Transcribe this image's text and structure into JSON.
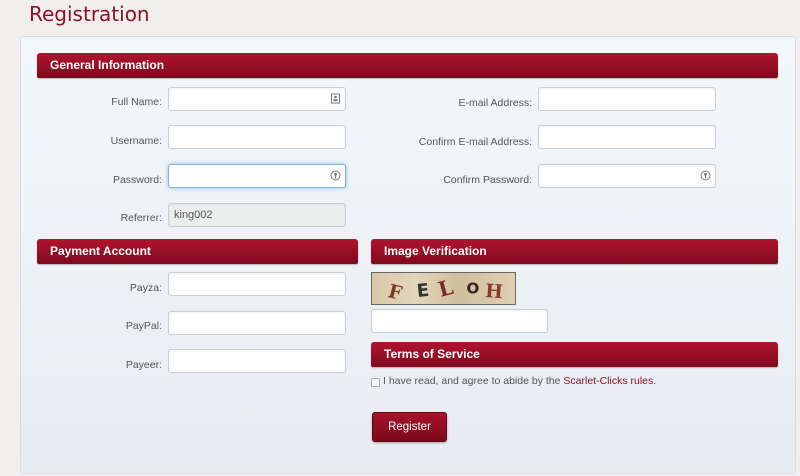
{
  "page": {
    "title": "Registration"
  },
  "general": {
    "title": "General Information",
    "full_name_label": "Full Name:",
    "username_label": "Username:",
    "password_label": "Password:",
    "referrer_label": "Referrer:",
    "referrer_value": "king002",
    "email_label": "E-mail Address:",
    "confirm_email_label": "Confirm E-mail Address:",
    "confirm_password_label": "Confirm Password:"
  },
  "payment": {
    "title": "Payment Account",
    "payza_label": "Payza:",
    "paypal_label": "PayPal:",
    "payeer_label": "Payeer:"
  },
  "verification": {
    "title": "Image Verification",
    "captcha_text": "FELOH"
  },
  "tos": {
    "title": "Terms of Service",
    "agree_text": "I have read, and agree to abide by the ",
    "link_text": "Scarlet-Clicks rules",
    "agree_suffix": "."
  },
  "actions": {
    "register_label": "Register"
  },
  "colors": {
    "accent": "#8a1126",
    "bar": "#a0112b"
  },
  "icons": {
    "full_name_field": "contact-card-icon",
    "password_field": "key-icon",
    "confirm_password_field": "key-icon"
  }
}
